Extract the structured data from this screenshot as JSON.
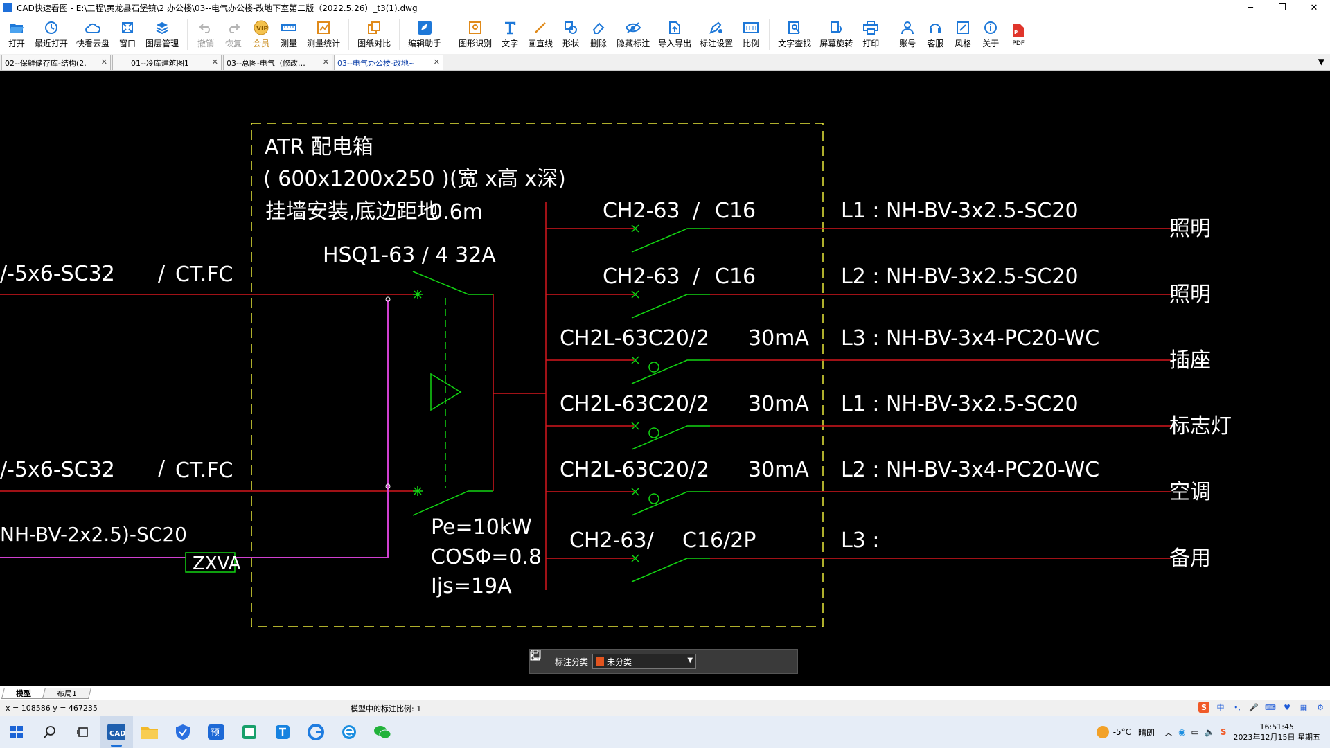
{
  "window": {
    "title": "CAD快速看图 - E:\\工程\\黄龙县石堡镇\\2  办公楼\\03--电气办公楼-改地下室第二版（2022.5.26）_t3(1).dwg",
    "minimize": "─",
    "restore": "❐",
    "close": "✕"
  },
  "toolbar": {
    "open": "打开",
    "recent": "最近打开",
    "cloud": "快看云盘",
    "window": "窗口",
    "layers": "图层管理",
    "undo": "撤销",
    "redo": "恢复",
    "vip": "会员",
    "measure": "测量",
    "measure_stats": "测量统计",
    "compare": "图纸对比",
    "edit_assistant": "编辑助手",
    "recognize": "图形识别",
    "text": "文字",
    "line": "画直线",
    "shape": "形状",
    "erase": "删除",
    "hide_marks": "隐藏标注",
    "import_export": "导入导出",
    "mark_settings": "标注设置",
    "ratio": "比例",
    "text_search": "文字查找",
    "rotate": "屏幕旋转",
    "print": "打印",
    "account": "账号",
    "service": "客服",
    "style": "风格",
    "about": "关于",
    "pdf": "PDF"
  },
  "tabs": [
    {
      "label": "02--保鲜储存库-结构(2.",
      "active": false
    },
    {
      "label": "01--冷库建筑图1",
      "active": false
    },
    {
      "label": "03--总图-电气（修改…",
      "active": false
    },
    {
      "label": "03--电气办公楼-改地~",
      "active": true
    }
  ],
  "drawing": {
    "box_title": "ATR   配电箱",
    "box_dims": "( 600x1200x250        )(宽    x高 x深)",
    "box_mount": "挂墙安装,底边距地",
    "box_height": "0.6m",
    "main_switch": "HSQ1-63     /  4    32A",
    "pe": "Pe=10kW",
    "cos": "COSΦ=0.8",
    "ijs": "Ijs=19A",
    "in1_cable": "/-5x6-SC32",
    "in1_ct": "CT.FC",
    "in2_cable": "/-5x6-SC32",
    "in2_ct": "CT.FC",
    "ctl_cable": "NH-BV-2x2.5)-SC20",
    "zxva": "ZXVA",
    "slash": "/",
    "circuits": [
      {
        "breaker": "CH2-63",
        "rating": "C16",
        "ma": "",
        "line": "L1 : NH-BV-3x2.5-SC20",
        "load": "照明"
      },
      {
        "breaker": "CH2-63",
        "rating": "C16",
        "ma": "",
        "line": "L2  : NH-BV-3x2.5-SC20",
        "load": "照明"
      },
      {
        "breaker": "CH2L-63C20/2",
        "rating": "",
        "ma": "30mA",
        "line": "L3  : NH-BV-3x4-PC20-WC",
        "load": "插座"
      },
      {
        "breaker": "CH2L-63C20/2",
        "rating": "",
        "ma": "30mA",
        "line": "L1  : NH-BV-3x2.5-SC20",
        "load": "标志灯"
      },
      {
        "breaker": "CH2L-63C20/2",
        "rating": "",
        "ma": "30mA",
        "line": "L2  : NH-BV-3x4-PC20-WC",
        "load": "空调"
      },
      {
        "breaker": "CH2-63/",
        "rating": "C16/2P",
        "ma": "",
        "line": "L3  :",
        "load": "备用"
      }
    ],
    "colors": {
      "red": "#d4171e",
      "green": "#12d412",
      "yellow": "#e8e83a",
      "white": "#ffffff",
      "magenta": "#d040d0"
    }
  },
  "floatbar": {
    "label": "标注分类",
    "category": "未分类"
  },
  "layout_tabs": [
    "模型",
    "布局1"
  ],
  "status": {
    "coords": "x = 108586  y = 467235",
    "scale": "模型中的标注比例: 1"
  },
  "taskbar": {
    "temp": "-5°C",
    "weather": "晴朗",
    "ime_lang": "中",
    "time": "16:51:45",
    "date": "2023年12月15日 星期五"
  }
}
